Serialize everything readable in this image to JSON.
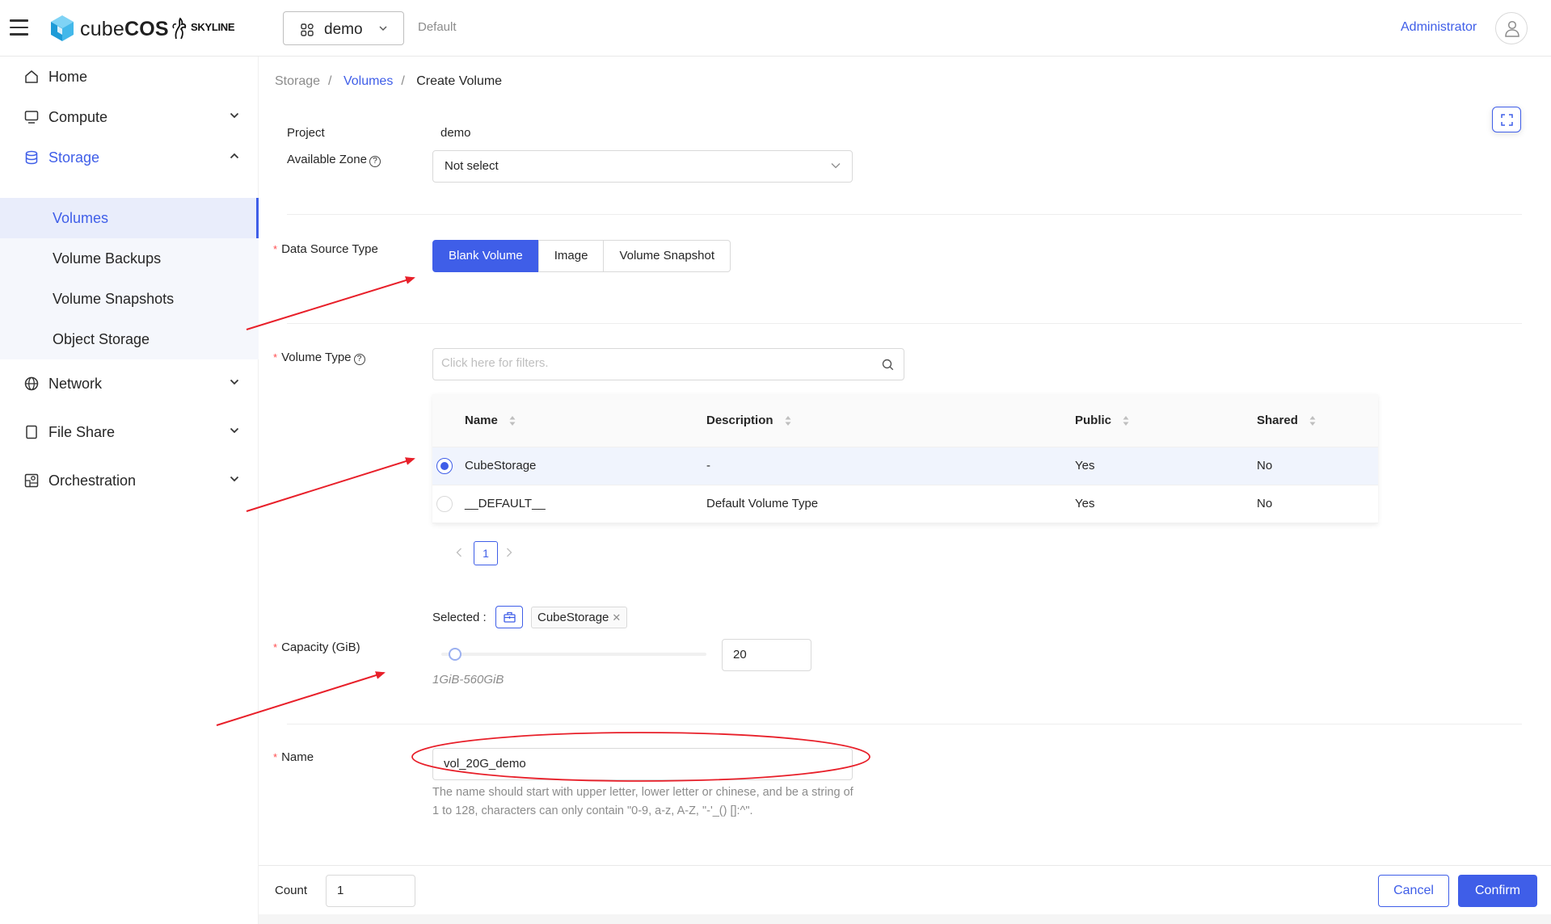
{
  "header": {
    "brand": {
      "light": "cube",
      "bold": "COS"
    },
    "partner_logo": "SKYLINE",
    "project": "demo",
    "domain": "Default",
    "user": "Administrator",
    "icons": {
      "menu": "hamburger-icon",
      "project": "grid-icon",
      "avatar": "user-icon"
    }
  },
  "sidebar": {
    "items": [
      {
        "label": "Home",
        "icon": "home-icon"
      },
      {
        "label": "Compute",
        "icon": "monitor-icon"
      },
      {
        "label": "Storage",
        "icon": "database-icon"
      },
      {
        "label": "Network",
        "icon": "globe-icon"
      },
      {
        "label": "File Share",
        "icon": "file-icon"
      },
      {
        "label": "Orchestration",
        "icon": "orchestration-icon"
      }
    ],
    "storage_children": [
      "Volumes",
      "Volume Backups",
      "Volume Snapshots",
      "Object Storage"
    ],
    "active_child": "Volumes"
  },
  "breadcrumb": [
    "Storage",
    "Volumes",
    "Create Volume"
  ],
  "form": {
    "project_label": "Project",
    "project_value": "demo",
    "zone_label": "Available Zone",
    "zone_value": "Not select",
    "data_source_label": "Data Source Type",
    "data_source_options": [
      "Blank Volume",
      "Image",
      "Volume Snapshot"
    ],
    "data_source_selected": "Blank Volume",
    "volume_type_label": "Volume Type",
    "filter_placeholder": "Click here for filters.",
    "table": {
      "columns": [
        "Name",
        "Description",
        "Public",
        "Shared"
      ],
      "rows": [
        {
          "name": "CubeStorage",
          "description": "-",
          "public": "Yes",
          "shared": "No",
          "selected": true
        },
        {
          "name": "__DEFAULT__",
          "description": "Default Volume Type",
          "public": "Yes",
          "shared": "No",
          "selected": false
        }
      ],
      "current_page": "1"
    },
    "selected_label": "Selected :",
    "selected_tag": "CubeStorage",
    "capacity_label": "Capacity (GiB)",
    "capacity_value": "20",
    "capacity_min": 1,
    "capacity_max": 560,
    "capacity_range_text": "1GiB-560GiB",
    "name_label": "Name",
    "name_value": "vol_20G_demo",
    "name_hint": "The name should start with upper letter, lower letter or chinese, and be a string of 1 to 128, characters can only contain \"0-9, a-z, A-Z, \"-'_() []:^\"."
  },
  "footer": {
    "count_label": "Count",
    "count_value": "1",
    "cancel_label": "Cancel",
    "confirm_label": "Confirm"
  },
  "colors": {
    "accent": "#3f5ee8",
    "annotation": "#e8202a",
    "required": "#ff4d4f"
  }
}
